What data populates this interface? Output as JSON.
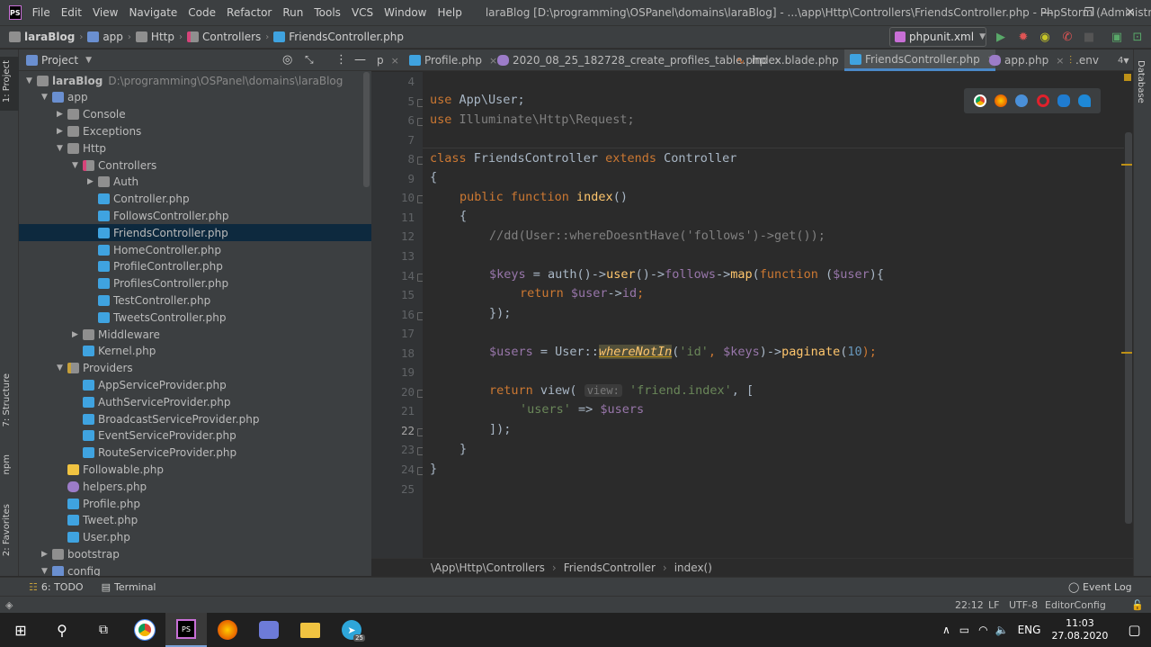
{
  "titlebar": {
    "app_badge": "PS",
    "menu": [
      "File",
      "Edit",
      "View",
      "Navigate",
      "Code",
      "Refactor",
      "Run",
      "Tools",
      "VCS",
      "Window",
      "Help"
    ],
    "window_title": "laraBlog [D:\\programming\\OSPanel\\domains\\laraBlog] - ...\\app\\Http\\Controllers\\FriendsController.php - PhpStorm (Administrator)"
  },
  "navbar": {
    "crumbs": [
      "laraBlog",
      "app",
      "Http",
      "Controllers",
      "FriendsController.php"
    ],
    "run_config": "phpunit.xml"
  },
  "left_tool_windows": [
    "1: Project",
    "7: Structure",
    "npm",
    "2: Favorites"
  ],
  "project_panel": {
    "title": "Project",
    "tree": [
      {
        "label": "laraBlog",
        "path": "D:\\programming\\OSPanel\\domains\\laraBlog",
        "type": "folder",
        "open": true
      },
      {
        "label": "app",
        "type": "folder",
        "open": true
      },
      {
        "label": "Console",
        "type": "folder",
        "open": false
      },
      {
        "label": "Exceptions",
        "type": "folder",
        "open": false
      },
      {
        "label": "Http",
        "type": "folder",
        "open": true
      },
      {
        "label": "Controllers",
        "type": "folder",
        "open": true
      },
      {
        "label": "Auth",
        "type": "folder",
        "open": false
      },
      {
        "label": "Controller.php",
        "type": "php"
      },
      {
        "label": "FollowsController.php",
        "type": "php"
      },
      {
        "label": "FriendsController.php",
        "type": "php",
        "selected": true
      },
      {
        "label": "HomeController.php",
        "type": "php"
      },
      {
        "label": "ProfileController.php",
        "type": "php"
      },
      {
        "label": "ProfilesController.php",
        "type": "php"
      },
      {
        "label": "TestController.php",
        "type": "php"
      },
      {
        "label": "TweetsController.php",
        "type": "php"
      },
      {
        "label": "Middleware",
        "type": "folder",
        "open": false
      },
      {
        "label": "Kernel.php",
        "type": "php"
      },
      {
        "label": "Providers",
        "type": "folder",
        "open": true
      },
      {
        "label": "AppServiceProvider.php",
        "type": "php"
      },
      {
        "label": "AuthServiceProvider.php",
        "type": "php"
      },
      {
        "label": "BroadcastServiceProvider.php",
        "type": "php"
      },
      {
        "label": "EventServiceProvider.php",
        "type": "php"
      },
      {
        "label": "RouteServiceProvider.php",
        "type": "php"
      },
      {
        "label": "Followable.php",
        "type": "trait"
      },
      {
        "label": "helpers.php",
        "type": "elephant"
      },
      {
        "label": "Profile.php",
        "type": "php"
      },
      {
        "label": "Tweet.php",
        "type": "php"
      },
      {
        "label": "User.php",
        "type": "php"
      },
      {
        "label": "bootstrap",
        "type": "folder",
        "open": false
      },
      {
        "label": "config",
        "type": "folder",
        "open": true
      }
    ]
  },
  "tabs": [
    {
      "label": "p",
      "close": "×"
    },
    {
      "label": "Profile.php",
      "close": "×"
    },
    {
      "label": "2020_08_25_182728_create_profiles_table.php",
      "close": "×"
    },
    {
      "label": "index.blade.php",
      "close": "×"
    },
    {
      "label": "FriendsController.php",
      "close": "×",
      "active": true
    },
    {
      "label": "app.php",
      "close": "×"
    },
    {
      "label": ".env",
      "close": ""
    }
  ],
  "tabs_overflow": "4",
  "editor": {
    "line_numbers": [
      "4",
      "5",
      "6",
      "7",
      "8",
      "9",
      "10",
      "11",
      "12",
      "13",
      "14",
      "15",
      "16",
      "17",
      "18",
      "19",
      "20",
      "21",
      "22",
      "23",
      "24",
      "25"
    ],
    "current_line": "22",
    "code": {
      "l5": [
        "use ",
        "App\\User;"
      ],
      "l6": [
        "use ",
        "Illuminate\\Http\\Request;"
      ],
      "l8": [
        "class ",
        "FriendsController ",
        "extends ",
        "Controller"
      ],
      "l9": "{",
      "l10": [
        "public function ",
        "index",
        "()"
      ],
      "l11": "{",
      "l12": "//dd(User::whereDoesntHave('follows')->get());",
      "l14": [
        "$keys",
        " = ",
        "auth",
        "()->",
        "user",
        "()->",
        "follows",
        "->",
        "map",
        "(",
        "function",
        " (",
        "$user",
        "){"
      ],
      "l15": [
        "return ",
        "$user",
        "->",
        "id",
        ";"
      ],
      "l16": "});",
      "l18": [
        "$users",
        " = User::",
        "whereNotIn",
        "(",
        "'id'",
        ", ",
        "$keys",
        ")->",
        "paginate",
        "(",
        "10",
        ");"
      ],
      "l20": [
        "return ",
        "view",
        "( ",
        "view:",
        " ",
        "'friend.index'",
        ", ["
      ],
      "l21": [
        "'users'",
        " => ",
        "$users"
      ],
      "l22": "]);",
      "l23": "}",
      "l24": "}"
    }
  },
  "right_tool_windows": [
    "Database"
  ],
  "code_breadcrumb": [
    "\\App\\Http\\Controllers",
    "FriendsController",
    "index()"
  ],
  "bottom_tools": {
    "todo": "6: TODO",
    "terminal": "Terminal",
    "event_log": "Event Log"
  },
  "status": {
    "position": "22:12",
    "line_sep": "LF",
    "encoding": "UTF-8",
    "editor_config": "EditorConfig"
  },
  "taskbar": {
    "language": "ENG",
    "time": "11:03",
    "date": "27.08.2020",
    "badge": "25"
  }
}
